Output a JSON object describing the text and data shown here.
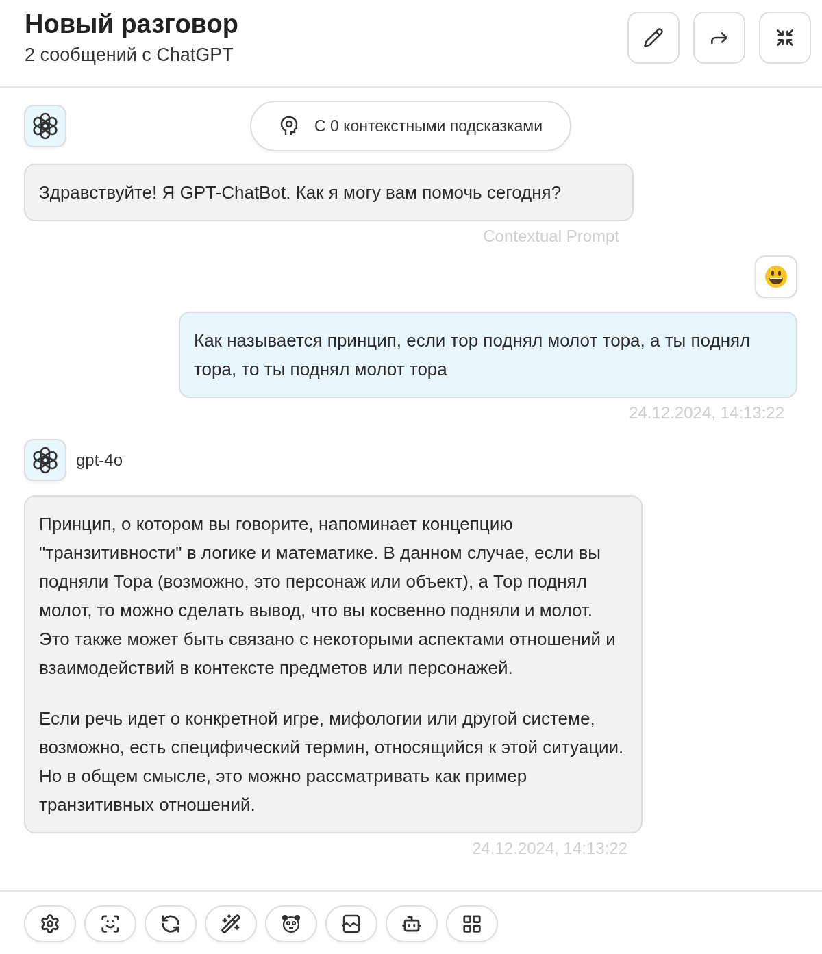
{
  "header": {
    "title": "Новый разговор",
    "subtitle": "2 сообщений с ChatGPT",
    "actions": [
      {
        "kind": "edit"
      },
      {
        "kind": "share"
      },
      {
        "kind": "collapse"
      }
    ]
  },
  "messages": [
    {
      "kind": "assistant",
      "context_chip": "С 0 контекстными подсказками",
      "paragraphs": [
        "Здравствуйте! Я GPT-ChatBot. Как я могу вам помочь сегодня?"
      ],
      "footnote": "Contextual Prompt"
    },
    {
      "kind": "user",
      "paragraphs": [
        "Как называется принцип, если тор поднял молот тора, а ты поднял тора, то ты поднял молот тора"
      ],
      "footnote": "24.12.2024, 14:13:22"
    },
    {
      "kind": "assistant",
      "model": "gpt-4o",
      "paragraphs": [
        "Принцип, о котором вы говорите, напоминает концепцию \"транзитивности\" в логике и математике. В данном случае, если вы подняли Тора (возможно, это персонаж или объект), а Тор поднял молот, то можно сделать вывод, что вы косвенно подняли и молот. Это также может быть связано с некоторыми аспектами отношений и взаимодействий в контексте предметов или персонажей.",
        "Если речь идет о конкретной игре, мифологии или другой системе, возможно, есть специфический термин, относящийся к этой ситуации. Но в общем смысле, это можно рассматривать как пример транзитивных отношений."
      ],
      "footnote": "24.12.2024, 14:13:22"
    }
  ],
  "toolbar": [
    {
      "kind": "settings"
    },
    {
      "kind": "image"
    },
    {
      "kind": "translate"
    },
    {
      "kind": "magic"
    },
    {
      "kind": "panda"
    },
    {
      "kind": "picture"
    },
    {
      "kind": "robot"
    },
    {
      "kind": "apps"
    }
  ]
}
